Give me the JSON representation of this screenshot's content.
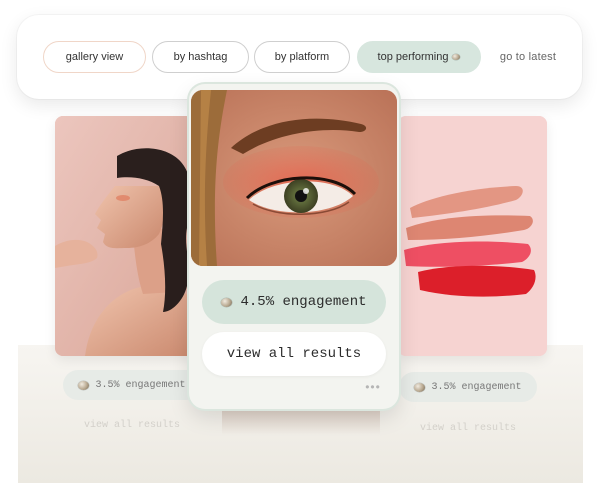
{
  "filters": {
    "gallery_view": "gallery view",
    "by_hashtag": "by hashtag",
    "by_platform": "by platform",
    "top_performing": "top performing",
    "go_to_latest": "go to latest"
  },
  "main_card": {
    "engagement": "4.5% engagement",
    "view_all": "view all results",
    "more": "•••"
  },
  "left_card": {
    "engagement": "3.5% engagement",
    "view_all": "view all results"
  },
  "right_card": {
    "engagement": "3.5% engagement",
    "view_all": "view all results"
  },
  "colors": {
    "accent_green": "#d5e4db",
    "chip_border": "#cfcfcf",
    "blush_bg": "#f6d3d1"
  },
  "icons": [
    "pebble-icon",
    "more-dots-icon"
  ]
}
